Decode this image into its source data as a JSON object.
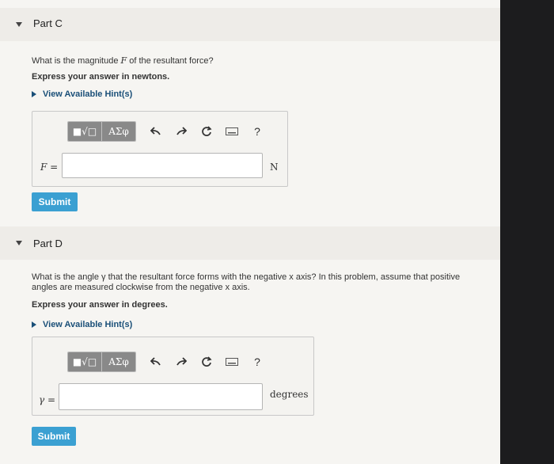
{
  "partC": {
    "title": "Part C",
    "question_a": "What is the magnitude ",
    "question_var": "F",
    "question_b": " of the resultant force?",
    "express": "Express your answer in newtons.",
    "hint": "View Available Hint(s)",
    "var_label": "F =",
    "unit": "N",
    "submit": "Submit"
  },
  "partD": {
    "title": "Part D",
    "question_line1": "What is the angle γ that the resultant force forms with the negative x axis? In this problem, assume that positive",
    "question_line2": "angles are measured  clockwise from the negative x axis.",
    "express": "Express your answer in degrees.",
    "hint": "View Available Hint(s)",
    "var_label": "γ =",
    "unit": "degrees",
    "submit": "Submit"
  },
  "toolbar": {
    "btn1": "■√□",
    "btn2": "ΑΣφ",
    "help": "?"
  },
  "colors": {
    "accent": "#3ba0d2",
    "toolbar_button": "#898989",
    "hint_link": "#1a4f78"
  }
}
